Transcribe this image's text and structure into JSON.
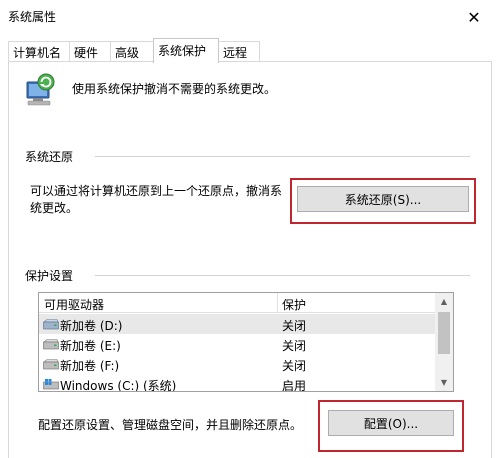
{
  "window": {
    "title": "系统属性",
    "close_glyph": "✕"
  },
  "tabs": [
    {
      "label": "计算机名",
      "active": false
    },
    {
      "label": "硬件",
      "active": false
    },
    {
      "label": "高级",
      "active": false
    },
    {
      "label": "系统保护",
      "active": true
    },
    {
      "label": "远程",
      "active": false
    }
  ],
  "header": {
    "text": "使用系统保护撤消不需要的系统更改。",
    "icon": "system-protection-icon"
  },
  "restore": {
    "group_title": "系统还原",
    "description_line1": "可以通过将计算机还原到上一个还原点，撤消系",
    "description_line2": "统更改。",
    "button_label": "系统还原(S)..."
  },
  "protection": {
    "group_title": "保护设置",
    "columns": [
      "可用驱动器",
      "保护"
    ],
    "rows": [
      {
        "name": "新加卷 (D:)",
        "status": "关闭",
        "icon": "drive-icon"
      },
      {
        "name": "新加卷 (E:)",
        "status": "关闭",
        "icon": "drive-icon"
      },
      {
        "name": "新加卷 (F:)",
        "status": "关闭",
        "icon": "drive-icon"
      },
      {
        "name": "Windows (C:) (系统)",
        "status": "启用",
        "icon": "windows-drive-icon"
      }
    ],
    "configure_text": "配置还原设置、管理磁盘空间，并且删除还原点。",
    "configure_button": "配置(O)..."
  },
  "colors": {
    "highlight_box": "#c0262d",
    "button_bg": "#e1e1e1",
    "selected_row": "#e8e8e8"
  }
}
